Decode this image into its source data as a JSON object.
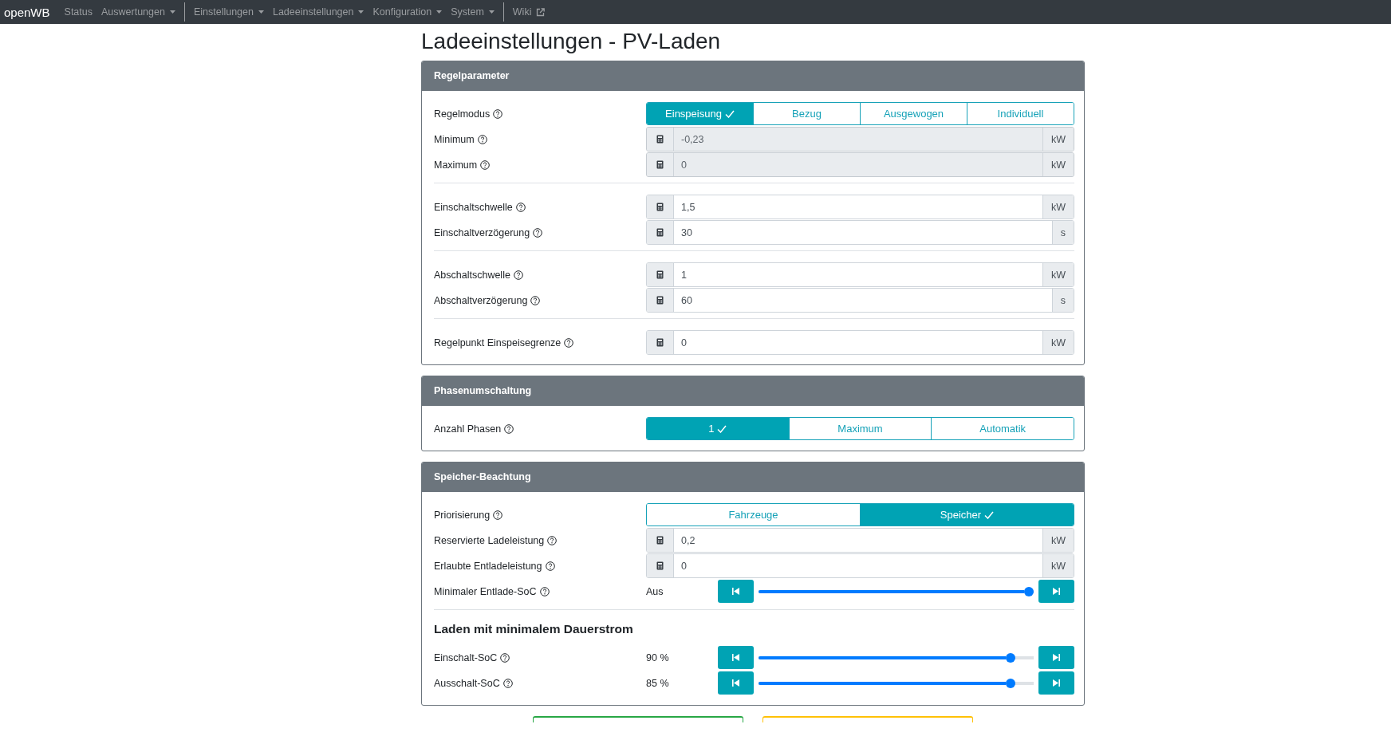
{
  "navbar": {
    "brand": "openWB",
    "items": [
      {
        "label": "Status",
        "kind": "link",
        "divider_before": false
      },
      {
        "label": "Auswertungen",
        "kind": "dropdown",
        "divider_before": false
      },
      {
        "label": "Einstellungen",
        "kind": "dropdown",
        "divider_before": true
      },
      {
        "label": "Ladeeinstellungen",
        "kind": "dropdown",
        "divider_before": false
      },
      {
        "label": "Konfiguration",
        "kind": "dropdown",
        "divider_before": false
      },
      {
        "label": "System",
        "kind": "dropdown",
        "divider_before": false
      },
      {
        "label": "Wiki",
        "kind": "external",
        "divider_before": true
      }
    ]
  },
  "page_title": "Ladeeinstellungen - PV-Laden",
  "sections": [
    {
      "title": "Regelparameter",
      "rows": [
        {
          "kind": "buttons",
          "label": "Regelmodus",
          "options": [
            {
              "label": "Einspeisung",
              "selected": true
            },
            {
              "label": "Bezug",
              "selected": false
            },
            {
              "label": "Ausgewogen",
              "selected": false
            },
            {
              "label": "Individuell",
              "selected": false
            }
          ]
        },
        {
          "kind": "number",
          "label": "Minimum",
          "value": "-0,23",
          "unit": "kW",
          "disabled": true
        },
        {
          "kind": "number",
          "label": "Maximum",
          "value": "0",
          "unit": "kW",
          "disabled": true
        },
        {
          "kind": "divider"
        },
        {
          "kind": "number",
          "label": "Einschaltschwelle",
          "value": "1,5",
          "unit": "kW",
          "disabled": false
        },
        {
          "kind": "number",
          "label": "Einschaltverzögerung",
          "value": "30",
          "unit": "s",
          "disabled": false
        },
        {
          "kind": "divider"
        },
        {
          "kind": "number",
          "label": "Abschaltschwelle",
          "value": "1",
          "unit": "kW",
          "disabled": false
        },
        {
          "kind": "number",
          "label": "Abschaltverzögerung",
          "value": "60",
          "unit": "s",
          "disabled": false
        },
        {
          "kind": "divider"
        },
        {
          "kind": "number",
          "label": "Regelpunkt Einspeisegrenze",
          "value": "0",
          "unit": "kW",
          "disabled": false
        }
      ]
    },
    {
      "title": "Phasenumschaltung",
      "rows": [
        {
          "kind": "buttons",
          "label": "Anzahl Phasen",
          "options": [
            {
              "label": "1",
              "selected": true
            },
            {
              "label": "Maximum",
              "selected": false
            },
            {
              "label": "Automatik",
              "selected": false
            }
          ]
        }
      ]
    },
    {
      "title": "Speicher-Beachtung",
      "rows": [
        {
          "kind": "buttons",
          "label": "Priorisierung",
          "options": [
            {
              "label": "Fahrzeuge",
              "selected": false
            },
            {
              "label": "Speicher",
              "selected": true
            }
          ]
        },
        {
          "kind": "number",
          "label": "Reservierte Ladeleistung",
          "value": "0,2",
          "unit": "kW",
          "disabled": false
        },
        {
          "kind": "number",
          "label": "Erlaubte Entladeleistung",
          "value": "0",
          "unit": "kW",
          "disabled": false
        },
        {
          "kind": "slider",
          "label": "Minimaler Entlade-SoC",
          "reading": "Aus",
          "level": 1
        },
        {
          "kind": "divider"
        },
        {
          "kind": "heading",
          "label": "Laden mit minimalem Dauerstrom"
        },
        {
          "kind": "slider",
          "label": "Einschalt-SoC",
          "reading": "90 %",
          "level": 0.93
        },
        {
          "kind": "slider",
          "label": "Ausschalt-SoC",
          "reading": "85 %",
          "level": 0.93
        }
      ]
    }
  ],
  "footer_buttons": [
    {
      "kind": "success"
    },
    {
      "kind": "warning"
    }
  ]
}
